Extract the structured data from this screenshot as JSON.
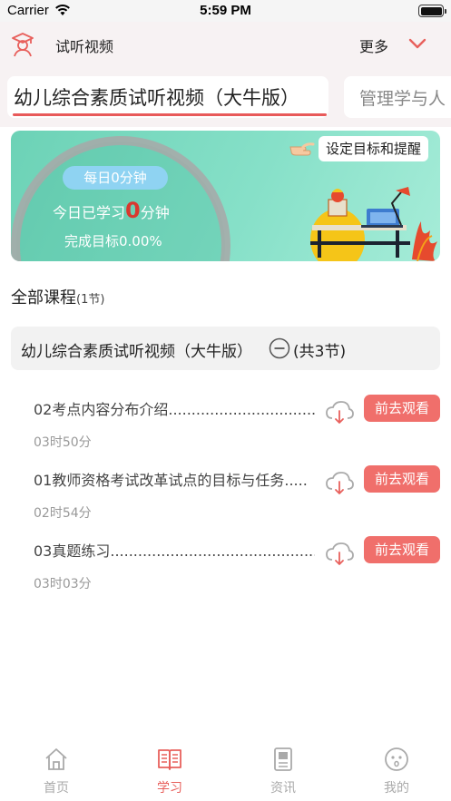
{
  "status_bar": {
    "carrier": "Carrier",
    "time": "5:59 PM"
  },
  "header": {
    "title": "试听视频",
    "more_label": "更多"
  },
  "course_tabs": [
    {
      "label": "幼儿综合素质试听视频（大牛版）",
      "active": true
    },
    {
      "label": "管理学与人",
      "active": false
    }
  ],
  "banner": {
    "daily_label": "每日0分钟",
    "studied_prefix": "今日已学习",
    "studied_value": "0",
    "studied_suffix": "分钟",
    "goal_label": "完成目标0.00%",
    "set_goal_label": "设定目标和提醒"
  },
  "section": {
    "title": "全部课程",
    "count": "(1节)"
  },
  "chapter": {
    "title": "幼儿综合素质试听视频（大牛版）",
    "count": "(共3节)"
  },
  "lessons": [
    {
      "title": "02考点内容分布介绍.............................................",
      "duration": "03时50分",
      "action": "前去观看"
    },
    {
      "title": "01教师资格考试改革试点的目标与任务.....",
      "duration": "02时54分",
      "action": "前去观看"
    },
    {
      "title": "03真题练习................................................................",
      "duration": "03时03分",
      "action": "前去观看"
    }
  ],
  "tabbar": [
    {
      "label": "首页",
      "icon": "home-icon",
      "active": false
    },
    {
      "label": "学习",
      "icon": "book-icon",
      "active": true
    },
    {
      "label": "资讯",
      "icon": "news-icon",
      "active": false
    },
    {
      "label": "我的",
      "icon": "profile-icon",
      "active": false
    }
  ],
  "colors": {
    "accent": "#e8605c",
    "button": "#f06f6b",
    "banner": "#86e0c8",
    "pill": "#8fd3f2"
  }
}
